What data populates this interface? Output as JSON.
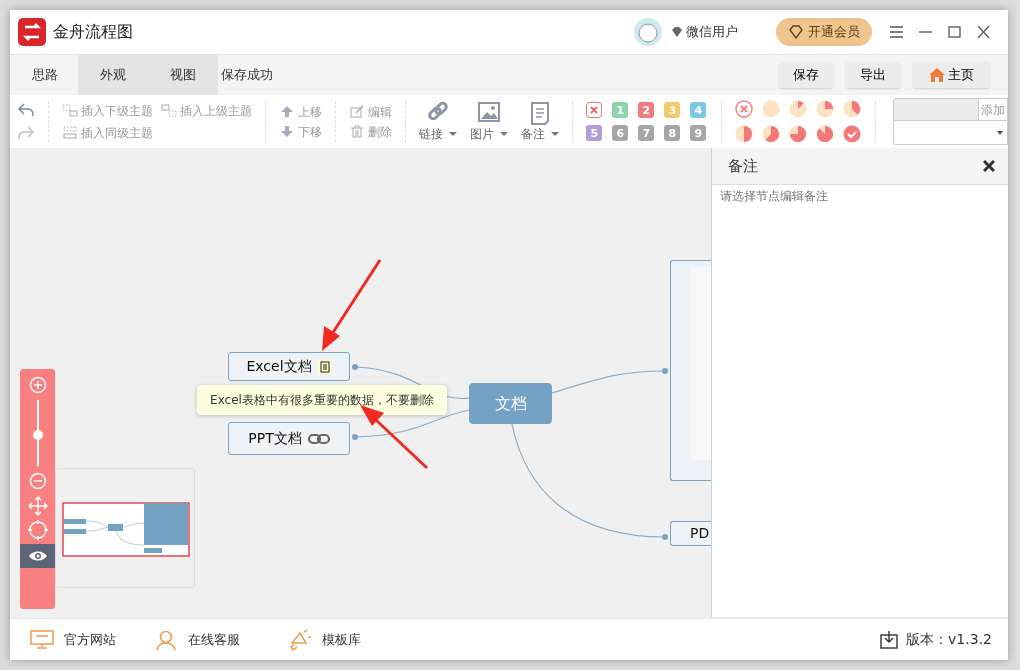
{
  "window": {
    "title": "金舟流程图"
  },
  "user": {
    "name": "微信用户"
  },
  "vip_button": "开通会员",
  "tabs": [
    {
      "label": "思路",
      "selected": true
    },
    {
      "label": "外观",
      "selected": false
    },
    {
      "label": "视图",
      "selected": false
    }
  ],
  "save_status": "保存成功",
  "header_buttons": [
    {
      "label": "保存",
      "kind": "plain"
    },
    {
      "label": "导出",
      "kind": "plain"
    },
    {
      "label": "主页",
      "kind": "home"
    }
  ],
  "toolbar": {
    "insert": [
      {
        "label": "插入下级主题",
        "kind": "child"
      },
      {
        "label": "插入上级主题",
        "kind": "parent"
      },
      {
        "label": "插入同级主题",
        "kind": "sibling"
      }
    ],
    "move": [
      {
        "label": "上移",
        "kind": "up"
      },
      {
        "label": "下移",
        "kind": "down"
      }
    ],
    "edit": [
      {
        "label": "编辑",
        "kind": "edit"
      },
      {
        "label": "删除",
        "kind": "delete"
      }
    ],
    "menus": [
      {
        "label": "链接",
        "kind": "link"
      },
      {
        "label": "图片",
        "kind": "image"
      },
      {
        "label": "备注",
        "kind": "note"
      }
    ]
  },
  "priorities": [
    {
      "kind": "clear",
      "color": "#e86b6b"
    },
    {
      "kind": "number",
      "label": "1",
      "color": "#8fd4a8"
    },
    {
      "kind": "number",
      "label": "2",
      "color": "#ee7d7d"
    },
    {
      "kind": "number",
      "label": "3",
      "color": "#f5c96a"
    },
    {
      "kind": "number",
      "label": "4",
      "color": "#7cc7e8"
    },
    {
      "kind": "number",
      "label": "5",
      "color": "#b39ddb"
    },
    {
      "kind": "number",
      "label": "6",
      "color": "#a6a6a6"
    },
    {
      "kind": "number",
      "label": "7",
      "color": "#a6a6a6"
    },
    {
      "kind": "number",
      "label": "8",
      "color": "#a6a6a6"
    },
    {
      "kind": "number",
      "label": "9",
      "color": "#a6a6a6"
    }
  ],
  "progress_icons": [
    {
      "kind": "clear"
    },
    {
      "kind": "empty"
    },
    {
      "kind": "eighth"
    },
    {
      "kind": "quarter"
    },
    {
      "kind": "three_eighths"
    },
    {
      "kind": "half"
    },
    {
      "kind": "five_eighths"
    },
    {
      "kind": "three_quarters"
    },
    {
      "kind": "seven_eighths"
    },
    {
      "kind": "done"
    }
  ],
  "style_box": {
    "button": "添加"
  },
  "canvas": {
    "nodes": [
      {
        "kind": "root",
        "label": "文档"
      },
      {
        "kind": "note_topic",
        "label": "Excel文档"
      },
      {
        "kind": "link_topic",
        "label": "PPT文档"
      },
      {
        "kind": "image"
      },
      {
        "kind": "topic",
        "label": "PD"
      }
    ],
    "tooltip": "Excel表格中有很多重要的数据，不要删除"
  },
  "zoom": {
    "level": 0.47
  },
  "notes_panel": {
    "title": "备注",
    "placeholder": "请选择节点编辑备注"
  },
  "footer": {
    "links": [
      {
        "label": "官方网站",
        "kind": "website"
      },
      {
        "label": "在线客服",
        "kind": "service"
      },
      {
        "label": "模板库",
        "kind": "templates"
      }
    ],
    "version": "版本：v1.3.2"
  }
}
